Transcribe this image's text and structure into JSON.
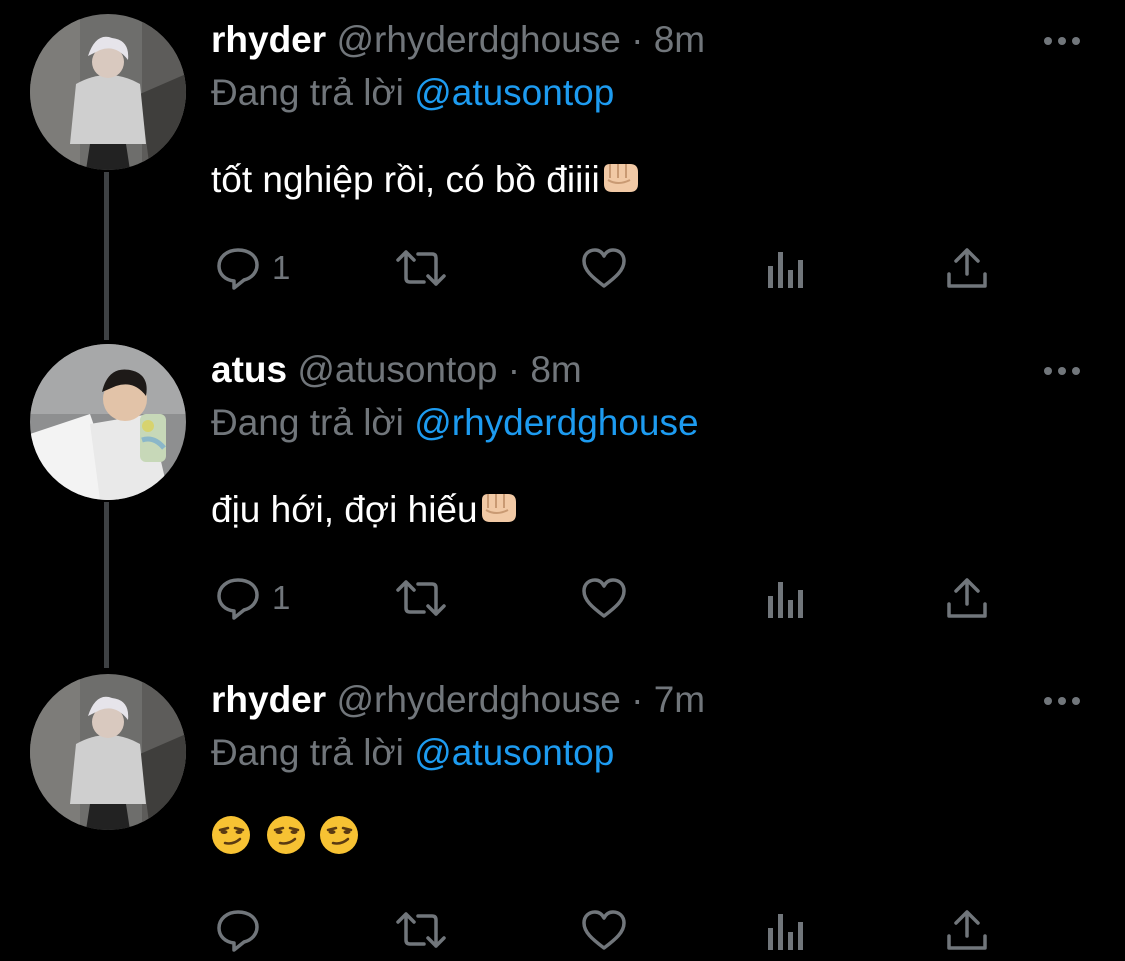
{
  "tweets": [
    {
      "name": "rhyder",
      "handle": "@rhyderdghouse",
      "separator": "·",
      "time": "8m",
      "reply_label": "Đang trả lời",
      "reply_mention": "@atusontop",
      "text": "tốt nghiệp rồi, có bồ điiii",
      "reply_count": "1"
    },
    {
      "name": "atus",
      "handle": "@atusontop",
      "separator": "·",
      "time": "8m",
      "reply_label": "Đang trả lời",
      "reply_mention": "@rhyderdghouse",
      "text": "địu hới, đợi hiếu",
      "reply_count": "1"
    },
    {
      "name": "rhyder",
      "handle": "@rhyderdghouse",
      "separator": "·",
      "time": "7m",
      "reply_label": "Đang trả lời",
      "reply_mention": "@atusontop",
      "text_emoji": [
        "smirking-face",
        "smirking-face",
        "smirking-face"
      ],
      "reply_count": ""
    }
  ],
  "icons": {
    "reply": "speech-bubble-icon",
    "retweet": "retweet-icon",
    "like": "heart-icon",
    "views": "bar-chart-icon",
    "share": "share-upload-icon",
    "more": "ellipsis-icon",
    "fist": "oncoming-fist-emoji"
  },
  "colors": {
    "background": "#000000",
    "name": "#ffffff",
    "muted": "#71767b",
    "mention": "#1d9bf0",
    "thread_line": "#3e4144"
  }
}
